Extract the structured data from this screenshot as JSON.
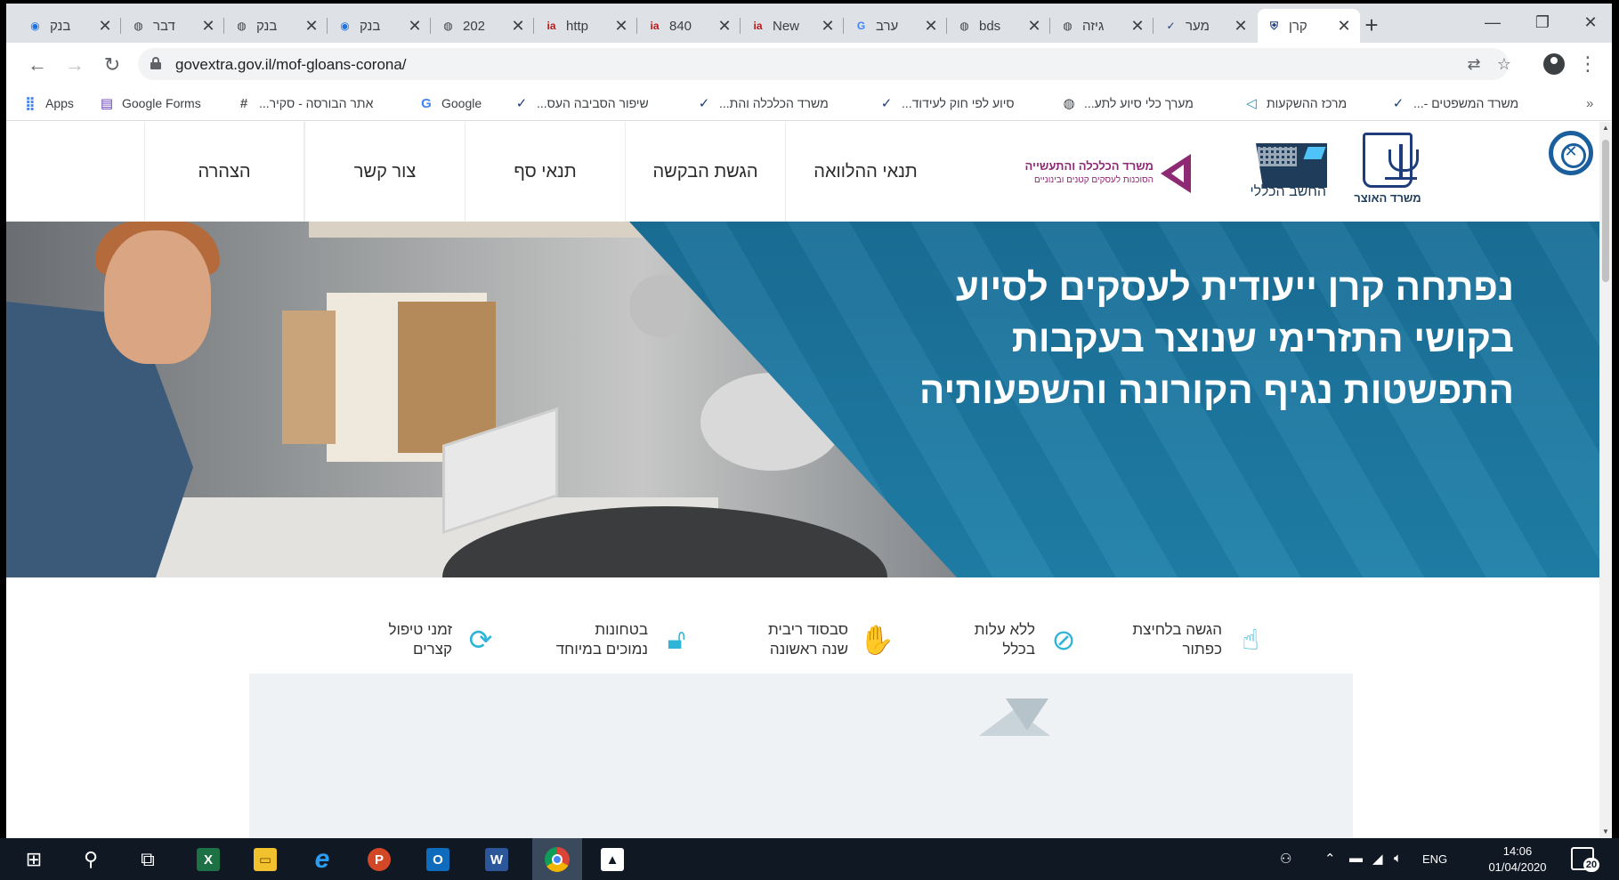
{
  "browser": {
    "tabs": [
      {
        "title": "בנק",
        "icon": "chrome-globe-icon",
        "active": false
      },
      {
        "title": "דבר",
        "icon": "globe-icon",
        "active": false
      },
      {
        "title": "בנק",
        "icon": "globe-icon",
        "active": false
      },
      {
        "title": "בנק",
        "icon": "chrome-globe-icon",
        "active": false
      },
      {
        "title": "202",
        "icon": "globe-icon",
        "active": false
      },
      {
        "title": "http",
        "icon": "news-logo-icon",
        "active": false
      },
      {
        "title": "840",
        "icon": "news-logo-icon",
        "active": false
      },
      {
        "title": "New",
        "icon": "news-logo-icon",
        "active": false
      },
      {
        "title": "ערב",
        "icon": "google-icon",
        "active": false
      },
      {
        "title": "bds",
        "icon": "globe-icon",
        "active": false
      },
      {
        "title": "גיזה",
        "icon": "globe-icon",
        "active": false
      },
      {
        "title": "מער",
        "icon": "checkmark-icon",
        "active": false
      },
      {
        "title": "קרן",
        "icon": "shield-icon",
        "active": true
      }
    ],
    "new_tab_label": "+",
    "close_glyph": "✕",
    "window_controls": {
      "minimize": "—",
      "restore": "❐",
      "close": "✕"
    },
    "url": "govextra.gov.il/mof-gloans-corona/",
    "bookmarks": [
      {
        "label": "Apps",
        "icon": "apps-grid-icon"
      },
      {
        "label": "Google Forms",
        "icon": "forms-icon"
      },
      {
        "label": "אתר הבורסה - סקיר...",
        "icon": "bookmark-icon"
      },
      {
        "label": "Google",
        "icon": "google-icon"
      },
      {
        "label": "שיפור הסביבה העס...",
        "icon": "checkmark-icon"
      },
      {
        "label": "משרד הכלכלה והת...",
        "icon": "checkmark-icon"
      },
      {
        "label": "סיוע לפי חוק לעידוד...",
        "icon": "checkmark-icon"
      },
      {
        "label": "מערך כלי סיוע לתע...",
        "icon": "globe-icon"
      },
      {
        "label": "מרכז ההשקעות",
        "icon": "triangle-logo-icon"
      },
      {
        "label": "משרד המשפטים -...",
        "icon": "checkmark-icon"
      }
    ],
    "more_bookmarks": "»"
  },
  "site": {
    "nav": [
      "הצהרה",
      "צור קשר",
      "תנאי סף",
      "הגשת הבקשה",
      "תנאי ההלוואה"
    ],
    "logos": {
      "economy_line1": "משרד הכלכלה והתעשייה",
      "economy_line2": "הסוכנות לעסקים קטנים ובינוניים",
      "cbs": "החשב הכללי",
      "treasury": "משרד האוצר"
    },
    "hero_title": "נפתחה קרן ייעודית לעסקים לסיוע בקושי התזרימי שנוצר בעקבות התפשטות נגיף הקורונה והשפעותיה",
    "features": [
      {
        "line1": "הגשה בלחיצת",
        "line2": "כפתור",
        "icon": "click-hand-icon"
      },
      {
        "line1": "ללא עלות",
        "line2": "בכלל",
        "icon": "no-cost-icon"
      },
      {
        "line1": "סבסוד ריבית",
        "line2": "שנה ראשונה",
        "icon": "interest-subsidy-icon"
      },
      {
        "line1": "בטחונות",
        "line2": "נמוכים במיוחד",
        "icon": "lock-open-icon"
      },
      {
        "line1": "זמני טיפול",
        "line2": "קצרים",
        "icon": "refresh-clock-icon"
      }
    ]
  },
  "taskbar": {
    "apps": [
      "windows-start-icon",
      "search-icon",
      "task-view-icon",
      "excel-icon",
      "file-explorer-icon",
      "internet-explorer-icon",
      "powerpoint-icon",
      "outlook-icon",
      "word-icon",
      "chrome-icon",
      "photos-icon"
    ],
    "tray_lang": "ENG",
    "time": "14:06",
    "date": "01/04/2020",
    "notifications": "20"
  },
  "colors": {
    "hero_blue": "#1f80a9",
    "feature_icon": "#2fb5d8",
    "economy_purple": "#8e2a73",
    "tabstrip": "#dee1e6",
    "taskbar": "#101823"
  }
}
